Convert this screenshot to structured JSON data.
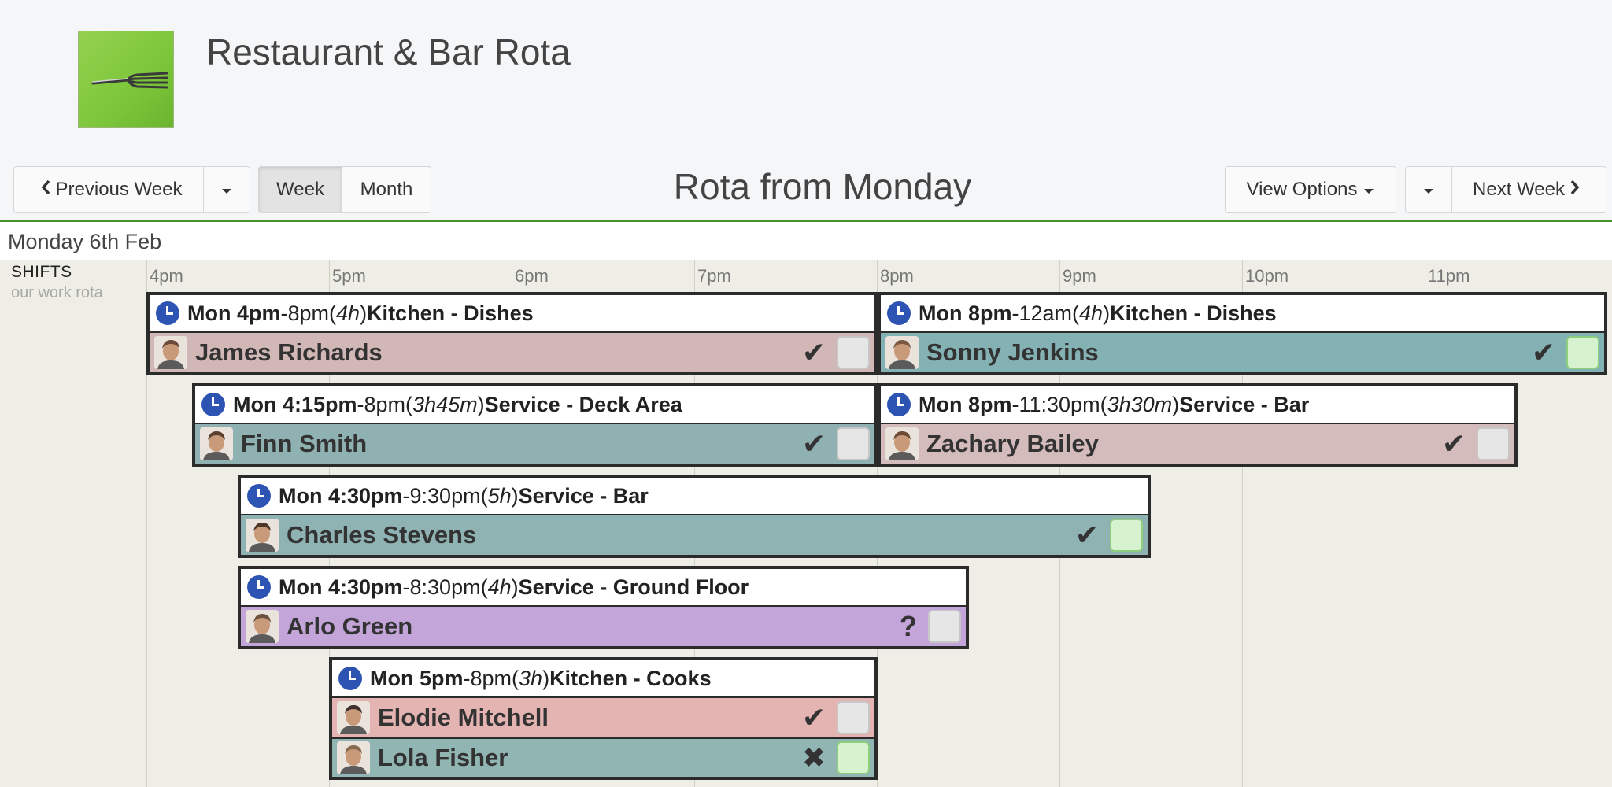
{
  "app": {
    "title": "Restaurant & Bar Rota",
    "logo_icon": "fork-icon"
  },
  "toolbar": {
    "previous_week": "Previous Week",
    "week": "Week",
    "month": "Month",
    "rota_title": "Rota from Monday",
    "view_options": "View Options",
    "next_week": "Next Week",
    "active_view": "Week"
  },
  "day": {
    "title": "Monday 6th Feb"
  },
  "grid": {
    "shifts_label": "SHIFTS",
    "shifts_sublabel": "our work rota",
    "hours": [
      "4pm",
      "5pm",
      "6pm",
      "7pm",
      "8pm",
      "9pm",
      "10pm",
      "11pm"
    ]
  },
  "colors": {
    "accent_green": "#4a8f2a",
    "clock_blue": "#2d53b3",
    "pink": "#d6bcbc",
    "teal": "#8fb2b2",
    "teal_light": "#97b6b6",
    "purple": "#c1a4da",
    "salmon": "#e6b3b2"
  },
  "shifts": [
    {
      "start": "Mon 4pm",
      "end": "-8pm",
      "duration": "4h",
      "role": "Kitchen - Dishes",
      "staff": [
        {
          "name": "James Richards",
          "status": "✔",
          "confirmed": false,
          "color": "#d2b7b7"
        }
      ]
    },
    {
      "start": "Mon 8pm",
      "end": "-12am",
      "duration": "4h",
      "role": "Kitchen - Dishes",
      "staff": [
        {
          "name": "Sonny Jenkins",
          "status": "✔",
          "confirmed": true,
          "color": "#84b1b3"
        }
      ]
    },
    {
      "start": "Mon 4:15pm",
      "end": "-8pm",
      "duration": "3h45m",
      "role": "Service - Deck Area",
      "staff": [
        {
          "name": "Finn Smith",
          "status": "✔",
          "confirmed": false,
          "color": "#8fb1b1"
        }
      ]
    },
    {
      "start": "Mon 8pm",
      "end": "-11:30pm",
      "duration": "3h30m",
      "role": "Service - Bar",
      "staff": [
        {
          "name": "Zachary Bailey",
          "status": "✔",
          "confirmed": false,
          "color": "#d4bcbc"
        }
      ]
    },
    {
      "start": "Mon 4:30pm",
      "end": "-9:30pm",
      "duration": "5h",
      "role": "Service - Bar",
      "staff": [
        {
          "name": "Charles Stevens",
          "status": "✔",
          "confirmed": true,
          "color": "#8fb2b2"
        }
      ]
    },
    {
      "start": "Mon 4:30pm",
      "end": "-8:30pm",
      "duration": "4h",
      "role": "Service - Ground Floor",
      "staff": [
        {
          "name": "Arlo Green",
          "status": "?",
          "confirmed": false,
          "color": "#c3a5da"
        }
      ]
    },
    {
      "start": "Mon 5pm",
      "end": "-8pm",
      "duration": "3h",
      "role": "Kitchen - Cooks",
      "staff": [
        {
          "name": "Elodie Mitchell",
          "status": "✔",
          "confirmed": false,
          "color": "#e4b4b3"
        },
        {
          "name": "Lola Fisher",
          "status": "✖",
          "confirmed": true,
          "color": "#90b5b3"
        }
      ]
    }
  ]
}
